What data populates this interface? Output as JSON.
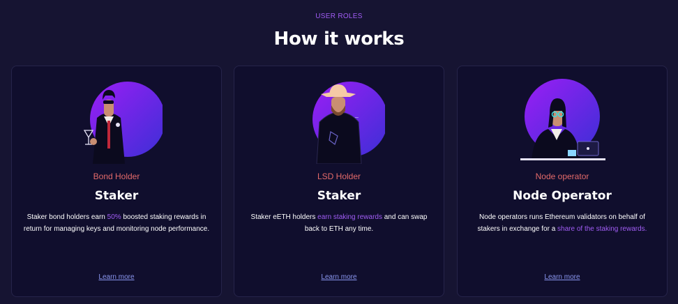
{
  "section": {
    "eyebrow": "USER ROLES",
    "heading": "How it works"
  },
  "colors": {
    "background": "#161432",
    "card_background": "#100e2d",
    "accent_purple": "#a15df5",
    "role_red": "#e46a6a",
    "link_blue": "#8a96ef"
  },
  "cards": [
    {
      "illustration": "bond-holder-figure-icon",
      "role": "Bond Holder",
      "title": "Staker",
      "desc_1": "Staker bond holders earn ",
      "desc_highlight": "50%",
      "desc_2": " boosted staking rewards in return for managing keys and monitoring node performance.",
      "link": "Learn more"
    },
    {
      "illustration": "lsd-holder-figure-icon",
      "role": "LSD Holder",
      "title": "Staker",
      "desc_1": "Staker eETH holders ",
      "desc_highlight": "earn staking rewards",
      "desc_2": " and can swap back to ETH any time.",
      "link": "Learn more"
    },
    {
      "illustration": "node-operator-figure-icon",
      "role": "Node operator",
      "title": "Node Operator",
      "desc_1": "Node operators runs Ethereum validators on behalf of stakers in exchange for a ",
      "desc_highlight": "share of the staking rewards.",
      "desc_2": "",
      "link": "Learn more"
    }
  ]
}
